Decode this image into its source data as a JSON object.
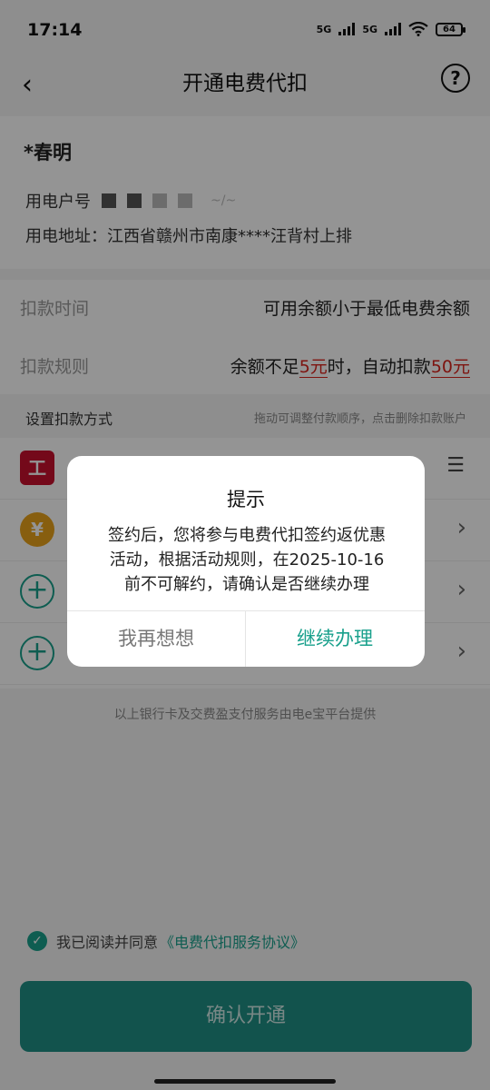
{
  "status_bar": {
    "time": "17:14",
    "signal1": "5G",
    "signal2": "5G",
    "battery": "64"
  },
  "nav": {
    "title": "开通电费代扣",
    "help_glyph": "?"
  },
  "user": {
    "name": "*春明",
    "account_label": "用电户号",
    "account_tail": "~/~",
    "address": "用电地址：江西省赣州市南康****汪背村上排"
  },
  "rules": {
    "time_label": "扣款时间",
    "time_value": "可用余额小于最低电费余额",
    "rule_label": "扣款规则",
    "rule_prefix": "余额不足",
    "rule_threshold": "5元",
    "rule_middle": "时，自动扣款",
    "rule_amount": "50元"
  },
  "method_header": {
    "title": "设置扣款方式",
    "hint": "拖动可调整付款顺序，点击删除扣款账户"
  },
  "methods": [
    {
      "icon": "icbc-logo-icon",
      "glyph": "工"
    },
    {
      "icon": "yuan-icon",
      "glyph": "¥"
    },
    {
      "icon": "plus-icon",
      "glyph": "+"
    },
    {
      "icon": "plus-icon",
      "glyph": "+"
    }
  ],
  "footer_note": "以上银行卡及交费盈支付服务由电e宝平台提供",
  "agreement": {
    "prefix": "我已阅读并同意",
    "link": "《电费代扣服务协议》"
  },
  "confirm_button": "确认开通",
  "dialog": {
    "title": "提示",
    "message": "签约后，您将参与电费代扣签约返优惠活动，根据活动规则，在2025-10-16前不可解约，请确认是否继续办理",
    "cancel": "我再想想",
    "confirm": "继续办理"
  },
  "colors": {
    "accent": "#19a08c",
    "warning": "#d9241c"
  }
}
